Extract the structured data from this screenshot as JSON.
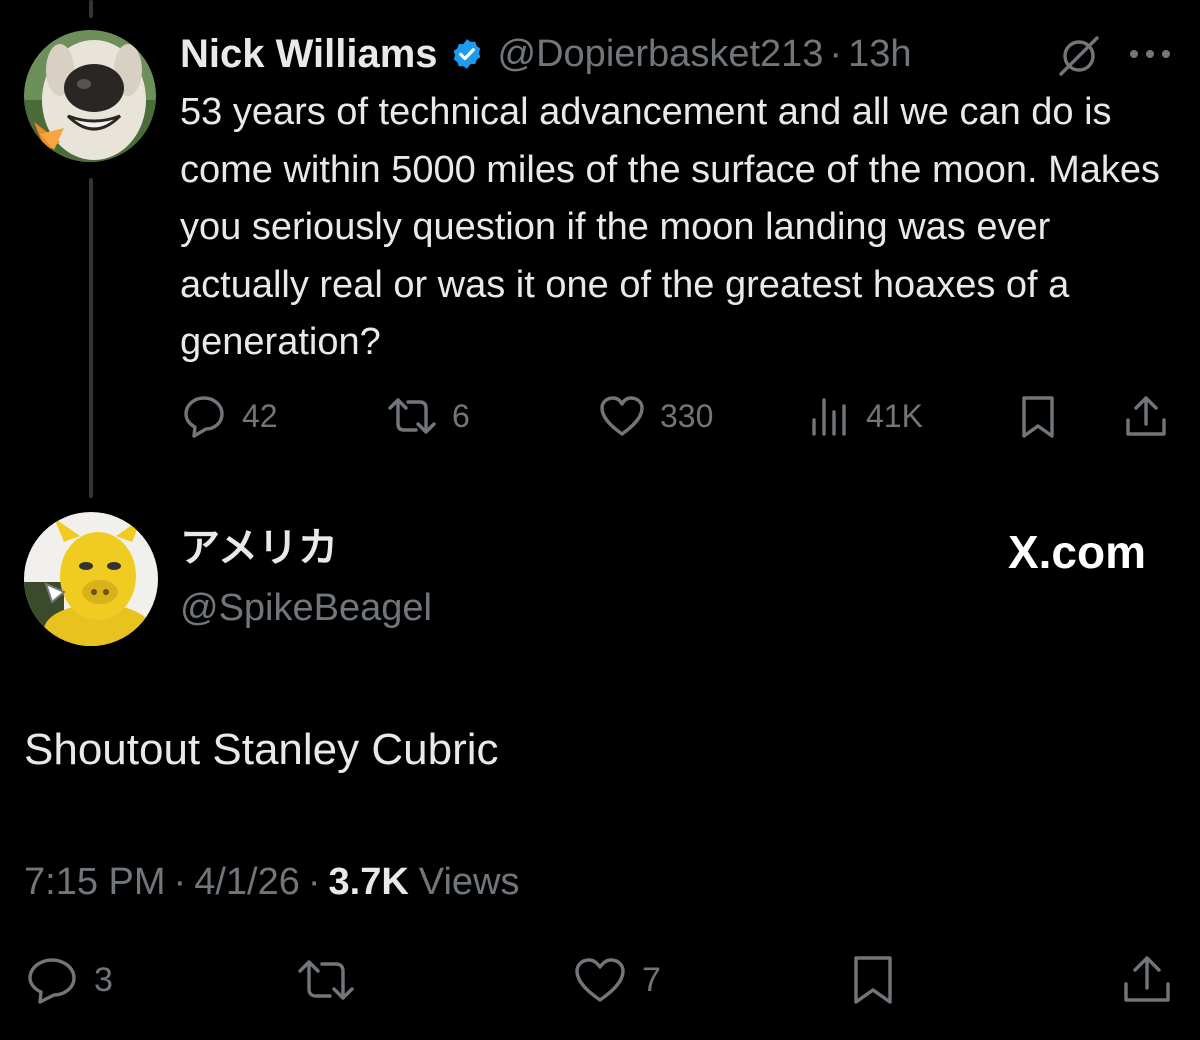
{
  "original_post": {
    "author_name": "Nick Williams",
    "handle": "@Dopierbasket213",
    "separator": "·",
    "time_ago": "13h",
    "text": "53 years of technical advancement and all we can do is come within 5000 miles of the surface of the moon.  Makes you seriously question if the moon landing was ever actually real or was it one of the greatest hoaxes of a generation?",
    "stats": {
      "replies": "42",
      "reposts": "6",
      "likes": "330",
      "views": "41K"
    },
    "icons": {
      "verified": "verified-badge-icon",
      "grok": "grok-icon",
      "more": "more-icon"
    },
    "accent_color": "#1d9bf0"
  },
  "reply": {
    "author_name": "アメリカ",
    "handle": "@SpikeBeagel",
    "text": "Shoutout Stanley Cubric",
    "time": "7:15 PM",
    "date": "4/1/26",
    "separator": "·",
    "views_count": "3.7K",
    "views_label": "Views",
    "stats": {
      "replies": "3",
      "likes": "7"
    },
    "watermark": "X.com"
  }
}
